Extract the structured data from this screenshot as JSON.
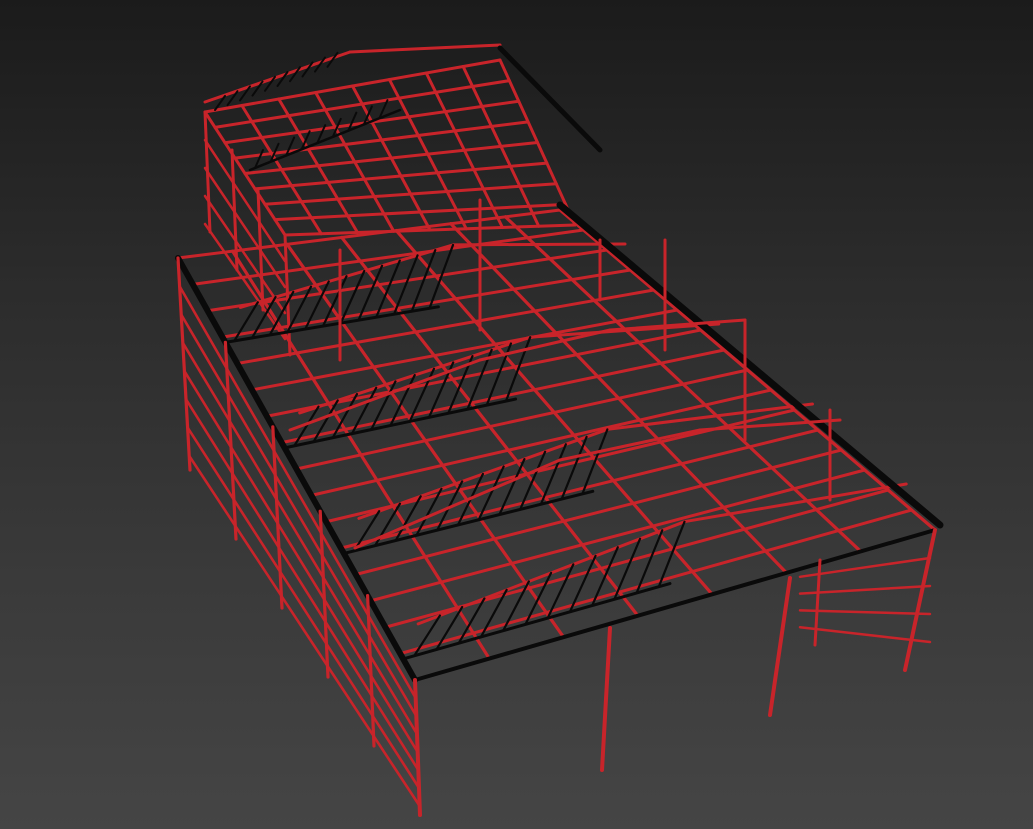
{
  "viewport": {
    "background_top": "#1b1b1b",
    "background_bottom": "#454545"
  },
  "model": {
    "subject": "steel-frame-warehouse-wireframe",
    "member_color": "#c8242a",
    "truss_color": "#0a0a0a"
  }
}
